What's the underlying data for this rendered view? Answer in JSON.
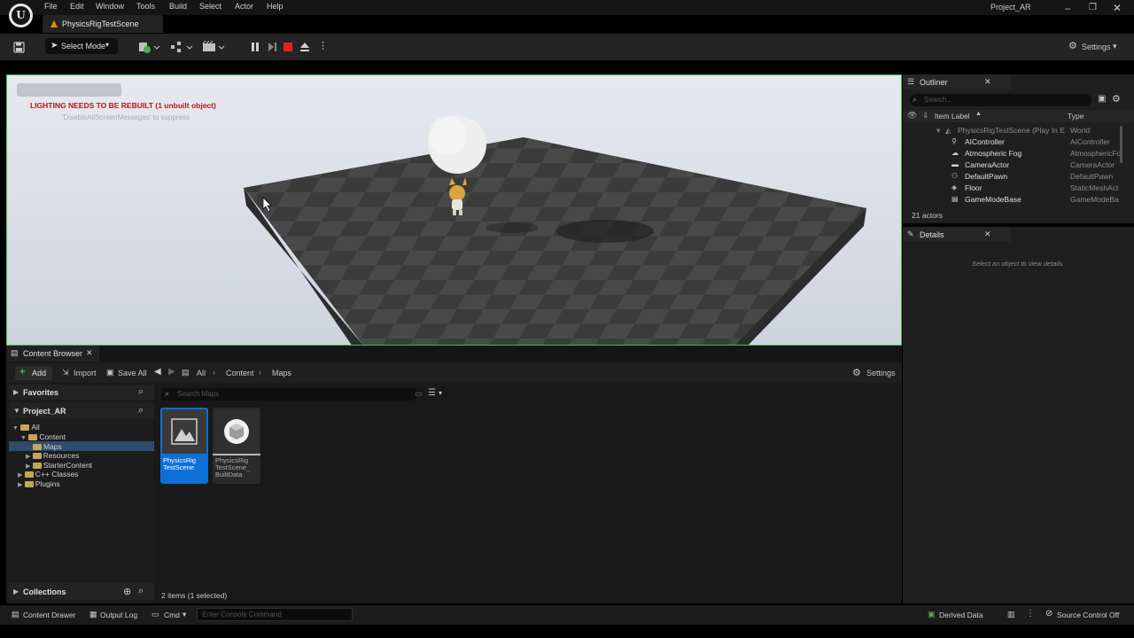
{
  "menu": {
    "items": [
      "File",
      "Edit",
      "Window",
      "Tools",
      "Build",
      "Select",
      "Actor",
      "Help"
    ],
    "project_title": "Project_AR"
  },
  "level_tab": {
    "label": "PhysicsRigTestScene"
  },
  "toolbar": {
    "select_mode": "Select Mode",
    "settings": "Settings"
  },
  "viewport": {
    "warning": "LIGHTING NEEDS TO BE REBUILT (1 unbuilt object)",
    "hint": "'DisableAllScreenMessages' to suppress"
  },
  "outliner": {
    "tab": "Outliner",
    "search_placeholder": "Search...",
    "col_label": "Item Label",
    "col_type": "Type",
    "root": {
      "label": "PhysicsRigTestScene (Play In E",
      "type": "World"
    },
    "rows": [
      {
        "label": "AIController",
        "type": "AIController",
        "icon": "controller-icon"
      },
      {
        "label": "Atmospheric Fog",
        "type": "AtmosphericFo",
        "icon": "fog-icon"
      },
      {
        "label": "CameraActor",
        "type": "CameraActor",
        "icon": "camera-icon"
      },
      {
        "label": "DefaultPawn",
        "type": "DefaultPawn",
        "icon": "pawn-icon"
      },
      {
        "label": "Floor",
        "type": "StaticMeshAct",
        "icon": "mesh-icon"
      },
      {
        "label": "GameModeBase",
        "type": "GameModeBa",
        "icon": "gamemode-icon"
      }
    ],
    "count": "21 actors"
  },
  "details": {
    "tab": "Details",
    "empty_message": "Select an object to view details"
  },
  "content_browser": {
    "tab": "Content Browser",
    "add": "Add",
    "import": "Import",
    "save_all": "Save All",
    "breadcrumb": [
      "All",
      "Content",
      "Maps"
    ],
    "settings": "Settings",
    "favorites": "Favorites",
    "project": "Project_AR",
    "search_placeholder": "Search Maps",
    "tree": [
      {
        "label": "All",
        "indent": 0
      },
      {
        "label": "Content",
        "indent": 1
      },
      {
        "label": "Maps",
        "indent": 2
      },
      {
        "label": "Resources",
        "indent": 2
      },
      {
        "label": "StarterContent",
        "indent": 2
      },
      {
        "label": "C++ Classes",
        "indent": 1
      },
      {
        "label": "Plugins",
        "indent": 1
      }
    ],
    "assets": [
      {
        "name": "PhysicsRig TestScene"
      },
      {
        "name": "PhysicsRig TestScene_ BuiltData"
      }
    ],
    "collections": "Collections",
    "status": "2 items (1 selected)"
  },
  "statusbar": {
    "content_drawer": "Content Drawer",
    "output_log": "Output Log",
    "cmd": "Cmd",
    "console_placeholder": "Enter Console Command",
    "derived_data": "Derived Data",
    "source_control": "Source Control Off"
  },
  "colors": {
    "accent_blue": "#0e6fd6",
    "viewport_border": "#3fbf4c",
    "warning_red": "#b01818",
    "level_icon": "#e68a1c"
  }
}
